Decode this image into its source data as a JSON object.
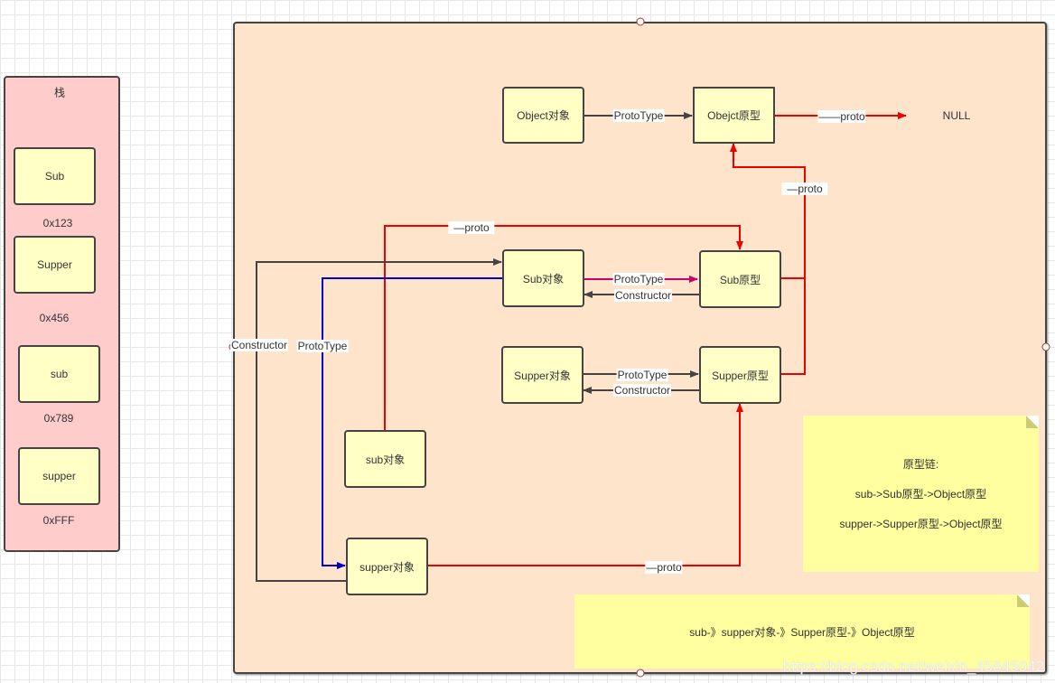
{
  "stack": {
    "title": "栈",
    "items": [
      {
        "label": "Sub",
        "address": "0x123"
      },
      {
        "label": "Supper",
        "address": "0x456"
      },
      {
        "label": "sub",
        "address": "0x789"
      },
      {
        "label": "supper",
        "address": "0xFFF"
      }
    ]
  },
  "nodes": {
    "object_obj": "Object对象",
    "object_proto": "Obejct原型",
    "null": "NULL",
    "sub_obj": "Sub对象",
    "sub_proto": "Sub原型",
    "supper_obj": "Supper对象",
    "supper_proto": "Supper原型",
    "sub_inst": "sub对象",
    "supper_inst": "supper对象"
  },
  "edges": {
    "object_prototype": "ProtoType",
    "object_proto_null": "——proto",
    "to_object_proto": "—proto",
    "sub_inst_proto": "—proto",
    "sub_prototype": "ProtoType",
    "sub_constructor": "Constructor",
    "supper_prototype": "ProtoType",
    "supper_constructor": "Constructor",
    "supper_inst_constructor": "Constructor",
    "sub_to_supper_prototype": "ProtoType",
    "supper_inst_proto": "—proto"
  },
  "notes": {
    "chain_title": "原型链:",
    "chain_sub": "sub->Sub原型->Object原型",
    "chain_supper": "supper->Supper原型->Object原型",
    "chain_bottom": "sub-》supper对象-》Supper原型-》Object原型"
  },
  "watermark": "https://blog.csdn.net/weixin_45845042",
  "colors": {
    "proto": "#ee0000",
    "prototype_blue": "#0000cc",
    "prototype_magenta": "#cc0066",
    "neutral": "#444444",
    "node_fill": "#ffffc6",
    "stack_fill": "#ffcccc",
    "panel_fill": "#ffe4cc",
    "note_fill": "#ffffa0"
  }
}
